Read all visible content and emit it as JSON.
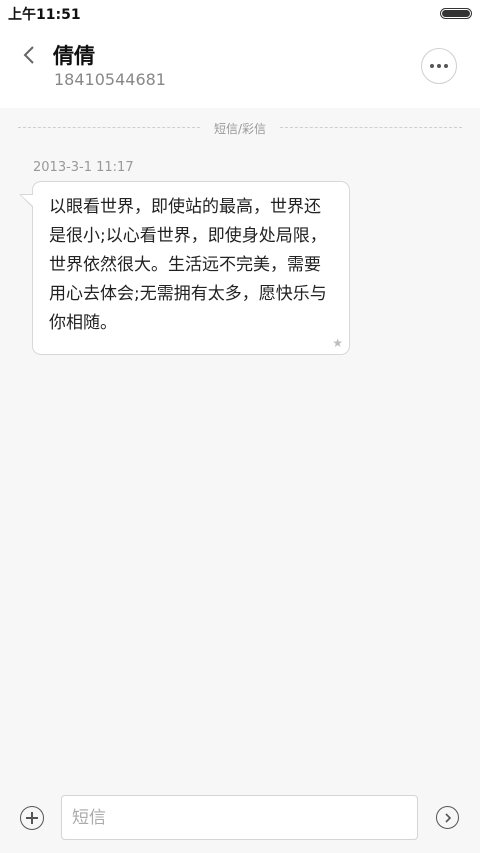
{
  "status_bar": {
    "time": "上午11:51",
    "battery_level": 1.0
  },
  "header": {
    "contact_name": "倩倩",
    "contact_number": "18410544681",
    "back_icon": "chevron-left-icon",
    "more_icon": "more-horizontal-icon"
  },
  "thread": {
    "divider_label": "短信/彩信",
    "messages": [
      {
        "timestamp": "2013-3-1 11:17",
        "text": "以眼看世界，即使站的最高，世界还是很小;以心看世界，即使身处局限，世界依然很大。生活远不完美，需要用心去体会;无需拥有太多，愿快乐与你相随。",
        "starred": true
      }
    ]
  },
  "compose": {
    "placeholder": "短信",
    "value": "",
    "add_icon": "plus-circle-icon",
    "send_icon": "send-arrow-icon"
  }
}
